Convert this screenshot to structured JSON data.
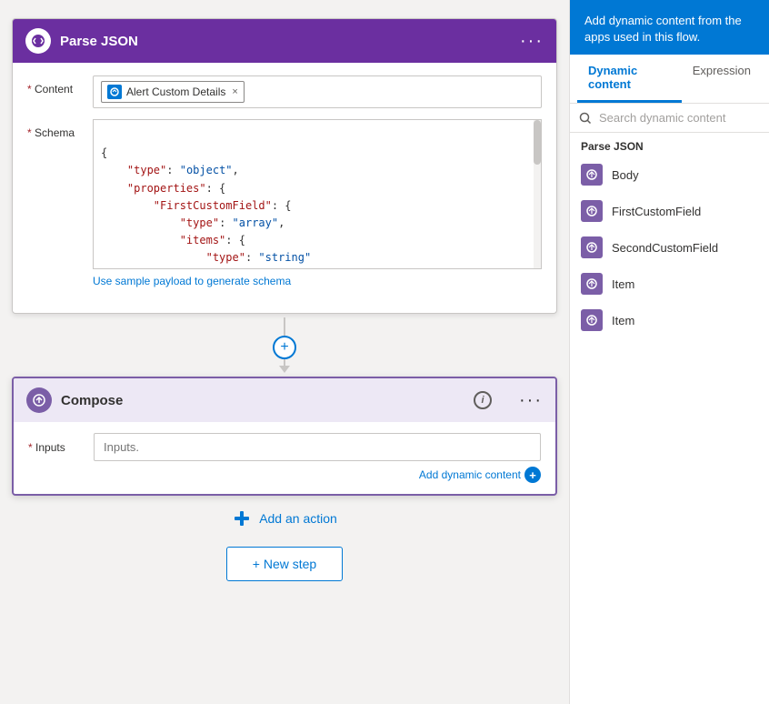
{
  "parse_json_card": {
    "title": "Parse JSON",
    "header_bg": "#6b2fa0",
    "content_label": "Content",
    "content_tag_text": "Alert Custom Details",
    "schema_label": "Schema",
    "schema_json": "{\n    \"type\": \"object\",\n    \"properties\": {\n        \"FirstCustomField\": {\n            \"type\": \"array\",\n            \"items\": {\n                \"type\": \"string\"\n            }\n        },\n        \"SecondCustomField\": {",
    "sample_link": "Use sample payload to generate schema"
  },
  "compose_card": {
    "title": "Compose",
    "inputs_label": "Inputs",
    "inputs_placeholder": "Inputs.",
    "add_dynamic_label": "Add dynamic content"
  },
  "add_action_label": "Add an action",
  "new_step_label": "+ New step",
  "right_panel": {
    "header_text": "Add dynamic content from the apps used in this flow.",
    "tab_dynamic": "Dynamic content",
    "tab_expression": "Expression",
    "search_placeholder": "Search dynamic content",
    "section_label": "Parse JSON",
    "items": [
      {
        "label": "Body"
      },
      {
        "label": "FirstCustomField"
      },
      {
        "label": "SecondCustomField"
      },
      {
        "label": "Item"
      },
      {
        "label": "Item"
      }
    ]
  }
}
